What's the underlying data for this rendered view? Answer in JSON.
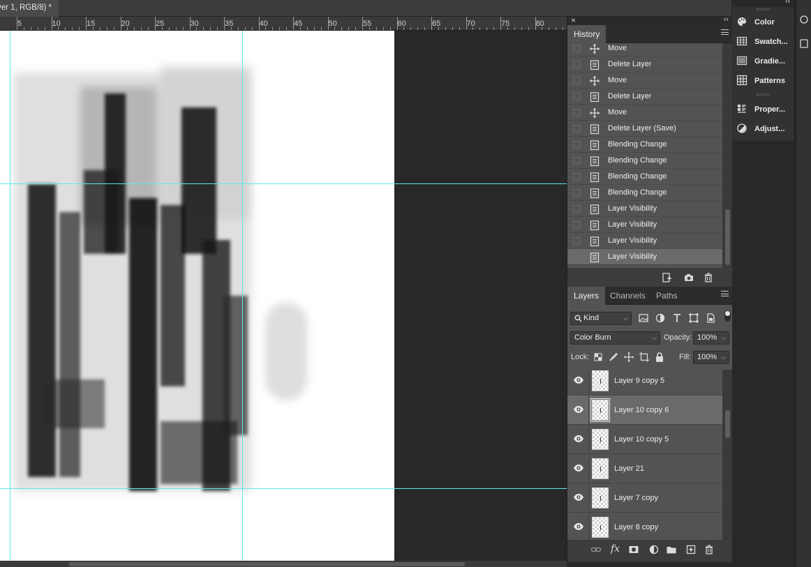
{
  "document": {
    "tab_title": "yer 1, RGB/8) *"
  },
  "ruler": {
    "labels": [
      "5",
      "10",
      "15",
      "20",
      "25",
      "30",
      "35",
      "40",
      "45",
      "50",
      "55",
      "60",
      "65",
      "70",
      "75",
      "80"
    ]
  },
  "history": {
    "tab_label": "History",
    "items": [
      {
        "label": "Move",
        "icon": "move-icon"
      },
      {
        "label": "Delete Layer",
        "icon": "document-icon"
      },
      {
        "label": "Move",
        "icon": "move-icon"
      },
      {
        "label": "Delete Layer",
        "icon": "document-icon"
      },
      {
        "label": "Move",
        "icon": "move-icon"
      },
      {
        "label": "Delete Layer (Save)",
        "icon": "document-icon"
      },
      {
        "label": "Blending Change",
        "icon": "document-icon"
      },
      {
        "label": "Blending Change",
        "icon": "document-icon"
      },
      {
        "label": "Blending Change",
        "icon": "document-icon"
      },
      {
        "label": "Blending Change",
        "icon": "document-icon"
      },
      {
        "label": "Layer Visibility",
        "icon": "document-icon"
      },
      {
        "label": "Layer Visibility",
        "icon": "document-icon"
      },
      {
        "label": "Layer Visibility",
        "icon": "document-icon"
      },
      {
        "label": "Layer Visibility",
        "icon": "document-icon",
        "selected": true
      }
    ]
  },
  "layers_panel": {
    "tabs": [
      "Layers",
      "Channels",
      "Paths"
    ],
    "filter_kind": "Kind",
    "blend_mode": "Color Burn",
    "opacity_label": "Opacity:",
    "opacity_value": "100%",
    "lock_label": "Lock:",
    "fill_label": "Fill:",
    "fill_value": "100%",
    "layers": [
      {
        "name": "Layer 9 copy 5",
        "visible": true,
        "selected": false
      },
      {
        "name": "Layer 10 copy 6",
        "visible": true,
        "selected": true
      },
      {
        "name": "Layer 10 copy 5",
        "visible": true,
        "selected": false
      },
      {
        "name": "Layer 21",
        "visible": true,
        "selected": false
      },
      {
        "name": "Layer 7 copy",
        "visible": true,
        "selected": false
      },
      {
        "name": "Layer 8 copy",
        "visible": true,
        "selected": false
      }
    ]
  },
  "dock": {
    "items": [
      {
        "label": "Color",
        "icon": "palette-icon"
      },
      {
        "label": "Swatch...",
        "icon": "grid-icon"
      },
      {
        "label": "Gradie...",
        "icon": "gradient-icon"
      },
      {
        "label": "Patterns",
        "icon": "patterns-icon"
      },
      {
        "label": "Proper...",
        "icon": "properties-icon"
      },
      {
        "label": "Adjust...",
        "icon": "adjust-icon"
      }
    ]
  },
  "colors": {
    "guide": "#5fe8e8",
    "panel_bg": "#535353",
    "selected_row": "#6a6a6a"
  }
}
